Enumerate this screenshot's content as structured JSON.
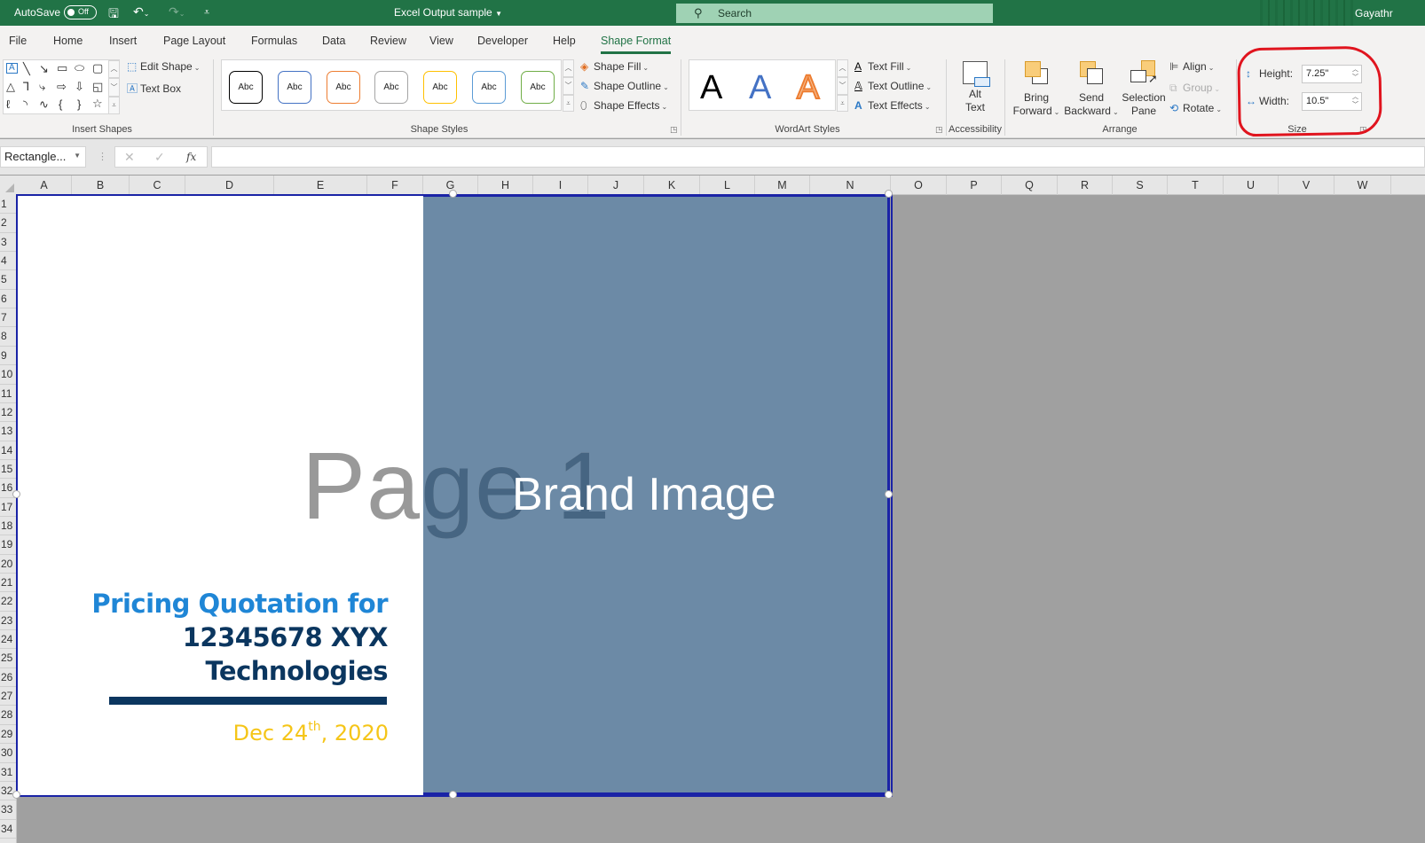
{
  "titlebar": {
    "autosave_label": "AutoSave",
    "autosave_state": "Off",
    "document_title": "Excel Output sample",
    "search_placeholder": "Search",
    "user_name": "Gayathr"
  },
  "tabs": [
    {
      "label": "File"
    },
    {
      "label": "Home"
    },
    {
      "label": "Insert"
    },
    {
      "label": "Page Layout"
    },
    {
      "label": "Formulas"
    },
    {
      "label": "Data"
    },
    {
      "label": "Review"
    },
    {
      "label": "View"
    },
    {
      "label": "Developer"
    },
    {
      "label": "Help"
    },
    {
      "label": "Shape Format",
      "active": true
    }
  ],
  "ribbon": {
    "insert_shapes": {
      "label": "Insert Shapes",
      "edit_shape": "Edit Shape",
      "text_box": "Text Box"
    },
    "shape_styles": {
      "label": "Shape Styles",
      "swatch_text": "Abc",
      "swatch_colors": [
        "#000000",
        "#4472c4",
        "#ed7d31",
        "#a5a5a5",
        "#ffc000",
        "#5b9bd5",
        "#70ad47"
      ],
      "shape_fill": "Shape Fill",
      "shape_outline": "Shape Outline",
      "shape_effects": "Shape Effects"
    },
    "wordart_styles": {
      "label": "WordArt Styles",
      "glyph": "A",
      "colors": [
        "#000000",
        "#4472c4",
        "#ed7d31"
      ],
      "text_fill": "Text Fill",
      "text_outline": "Text Outline",
      "text_effects": "Text Effects"
    },
    "accessibility": {
      "label": "Accessibility",
      "alt_text_line1": "Alt",
      "alt_text_line2": "Text"
    },
    "arrange": {
      "label": "Arrange",
      "bring_forward_1": "Bring",
      "bring_forward_2": "Forward",
      "send_backward_1": "Send",
      "send_backward_2": "Backward",
      "selection_pane_1": "Selection",
      "selection_pane_2": "Pane",
      "align": "Align",
      "group": "Group",
      "rotate": "Rotate"
    },
    "size": {
      "label": "Size",
      "height_label": "Height:",
      "height_value": "7.25\"",
      "width_label": "Width:",
      "width_value": "10.5\""
    }
  },
  "formula_bar": {
    "name_box": "Rectangle...",
    "cancel": "✕",
    "enter": "✓",
    "fx": "fx",
    "formula": ""
  },
  "columns": [
    "A",
    "B",
    "C",
    "D",
    "E",
    "F",
    "G",
    "H",
    "I",
    "J",
    "K",
    "L",
    "M",
    "N",
    "O",
    "P",
    "Q",
    "R",
    "S",
    "T",
    "U",
    "V",
    "W"
  ],
  "rows": [
    "1",
    "2",
    "3",
    "4",
    "5",
    "6",
    "7",
    "8",
    "9",
    "10",
    "11",
    "12",
    "13",
    "14",
    "15",
    "16",
    "17",
    "18",
    "19",
    "20",
    "21",
    "22",
    "23",
    "24",
    "25",
    "26",
    "27",
    "28",
    "29",
    "30",
    "31",
    "32",
    "33",
    "34"
  ],
  "sheet": {
    "watermark": "Page 1",
    "brand_image": "Brand Image",
    "quote_line1": "Pricing Quotation for",
    "quote_line2": "12345678 XYX",
    "quote_line3": "Technologies",
    "date_main": "Dec 24",
    "date_suffix": "th",
    "date_year": ", 2020",
    "colors": {
      "brand_fill": "#6c8aa6",
      "quote_blue": "#1f86d6",
      "quote_navy": "#0b365f",
      "date_yellow": "#f5c518",
      "selection_border": "#1a23a6"
    }
  }
}
